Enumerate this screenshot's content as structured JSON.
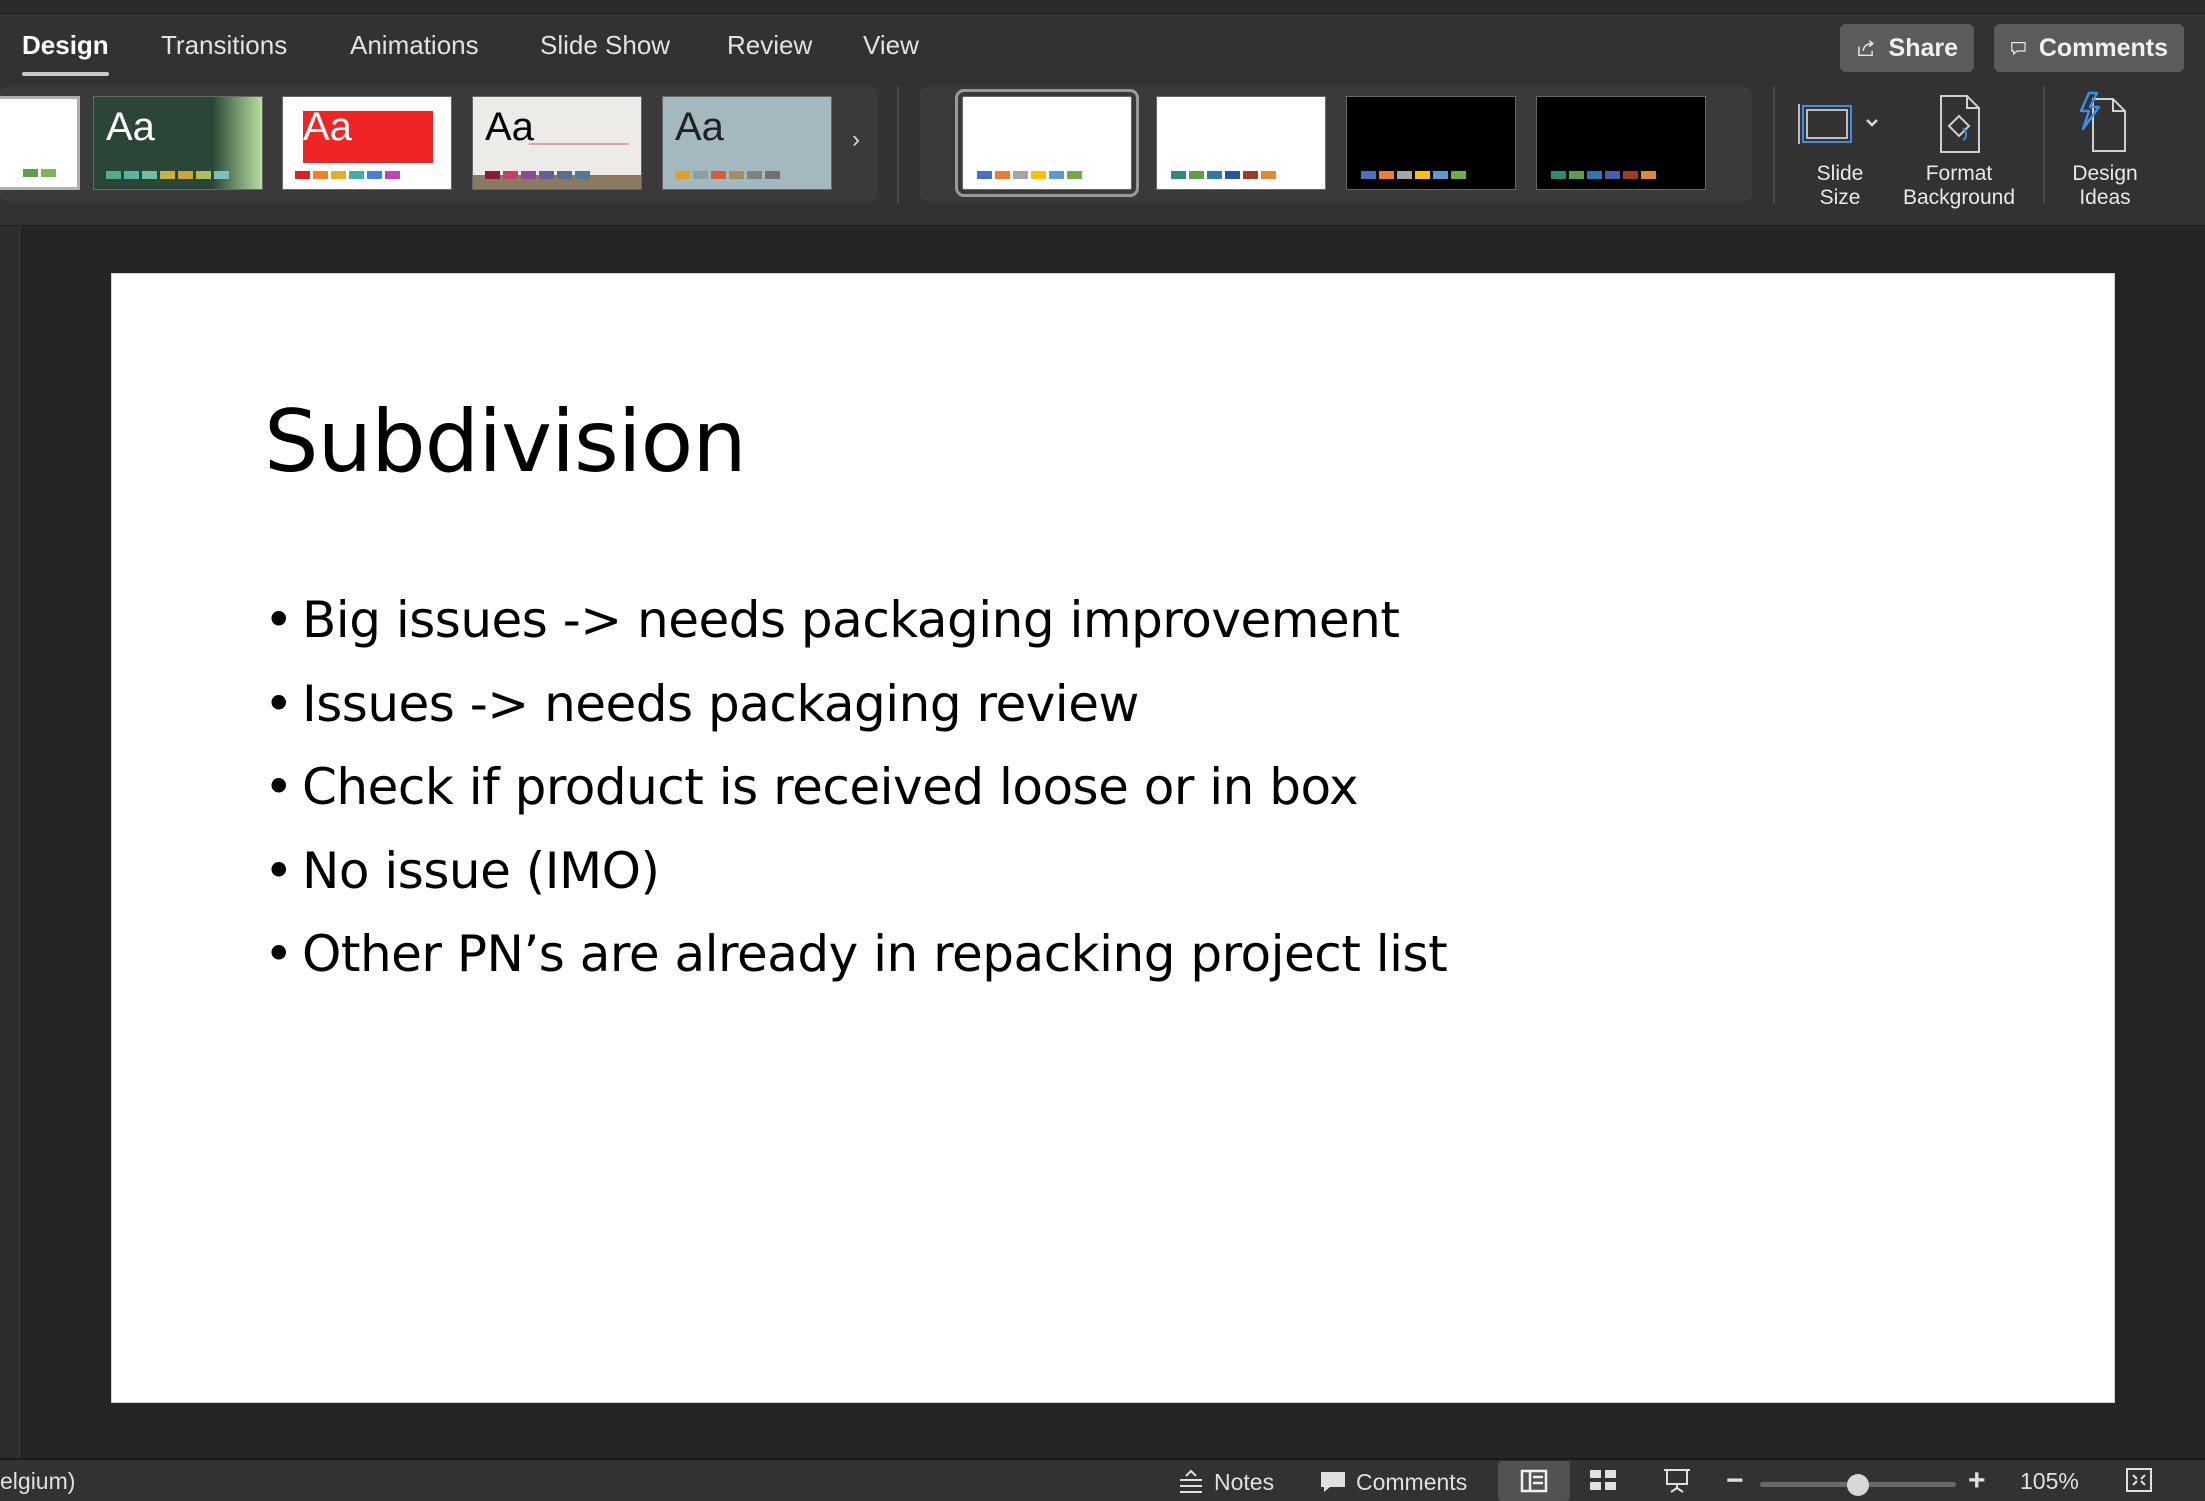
{
  "tabs": [
    {
      "label": "Design",
      "active": true
    },
    {
      "label": "Transitions"
    },
    {
      "label": "Animations"
    },
    {
      "label": "Slide Show"
    },
    {
      "label": "Review"
    },
    {
      "label": "View"
    }
  ],
  "top_buttons": {
    "share": "Share",
    "comments": "Comments"
  },
  "themes": [
    {
      "aa": "",
      "bg": "#ffffff",
      "fg": "#000",
      "swatches": [
        "#5aa04a",
        "#7fb55a"
      ]
    },
    {
      "aa": "Aa",
      "bg": "#294636",
      "fg": "#ffffff",
      "swatches": [
        "#4caf8a",
        "#5ab4a0",
        "#6ec0a0",
        "#c9b040",
        "#d4a040",
        "#a8c060",
        "#7cc0c0"
      ]
    },
    {
      "aa": "Aa",
      "bg": "#ffffff",
      "fg": "#ffffff",
      "swatches": [
        "#e02020",
        "#f08020",
        "#e0b020",
        "#40b0a0",
        "#4080e0",
        "#c040c0"
      ]
    },
    {
      "aa": "Aa",
      "bg": "#ecebe8",
      "fg": "#000",
      "swatches": [
        "#8a1a3a",
        "#c04070",
        "#8a4a9a",
        "#6a5a9a",
        "#5a6a9a",
        "#4a7a9a"
      ]
    },
    {
      "aa": "Aa",
      "bg": "#a4b8bf",
      "fg": "#222",
      "swatches": [
        "#e0a020",
        "#8aa0a0",
        "#d06040",
        "#a09060",
        "#808080",
        "#707070"
      ]
    }
  ],
  "variants": [
    {
      "bg": "#ffffff",
      "selected": true,
      "swatches": [
        "#4472c4",
        "#ed7d31",
        "#a5a5a5",
        "#ffc000",
        "#5b9bd5",
        "#70ad47"
      ]
    },
    {
      "bg": "#ffffff",
      "selected": false,
      "swatches": [
        "#2e8b7a",
        "#5aa04a",
        "#2a7ab0",
        "#1f5aa0",
        "#a03a20",
        "#e08a30"
      ]
    },
    {
      "bg": "#000000",
      "selected": false,
      "swatches": [
        "#4472c4",
        "#ed7d31",
        "#a5a5a5",
        "#ffc000",
        "#5b9bd5",
        "#70ad47"
      ]
    },
    {
      "bg": "#000000",
      "selected": false,
      "swatches": [
        "#2e8b7a",
        "#5aa04a",
        "#2a7ab0",
        "#4a5ab0",
        "#a03a20",
        "#e08a30"
      ]
    }
  ],
  "ribbon_buttons": {
    "slide_size": "Slide\nSize",
    "format_background": "Format\nBackground",
    "design_ideas": "Design\nIdeas"
  },
  "slide": {
    "title": "Subdivision",
    "bullets": [
      "Big issues -> needs packaging improvement",
      "Issues -> needs packaging review",
      "Check if product is received loose or in box",
      "No issue (IMO)",
      "Other PN’s are already in repacking project list"
    ]
  },
  "status": {
    "language": "elgium)",
    "notes": "Notes",
    "comments": "Comments",
    "zoom": "105%",
    "zoom_fraction": 0.5
  },
  "colors": {
    "accent_icon": "#3a8ee8"
  }
}
